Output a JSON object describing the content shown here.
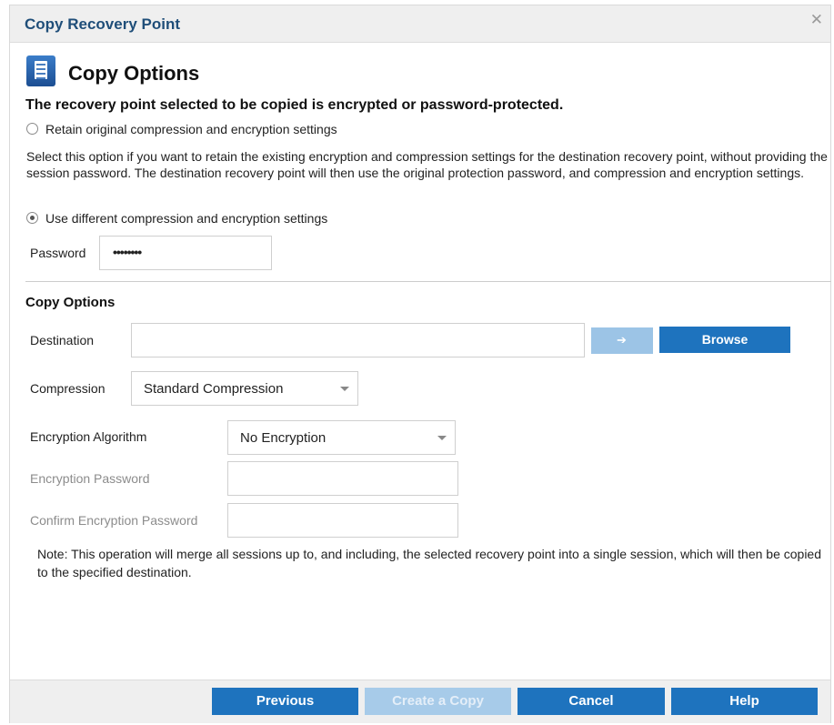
{
  "dialog": {
    "title": "Copy Recovery Point",
    "close_glyph": "✕"
  },
  "header": {
    "title": "Copy Options",
    "icon": "document-icon"
  },
  "warning": "The recovery point selected to be copied is encrypted or password-protected.",
  "options": {
    "retain_label": "Retain original compression and encryption settings",
    "retain_selected": false,
    "retain_description": "Select this option if you want to retain the existing encryption and compression settings for the destination recovery point, without providing the session password. The destination recovery point will then use the original protection password, and compression and encryption settings.",
    "different_label": "Use different compression and encryption settings",
    "different_selected": true
  },
  "password": {
    "label": "Password",
    "value": "••••••••"
  },
  "copy_options": {
    "section_title": "Copy Options",
    "destination_label": "Destination",
    "destination_value": "",
    "go_icon": "arrow-right-icon",
    "go_glyph": "➔",
    "browse_label": "Browse",
    "compression_label": "Compression",
    "compression_value": "Standard Compression",
    "encryption_algorithm_label": "Encryption Algorithm",
    "encryption_algorithm_value": "No Encryption",
    "encryption_password_label": "Encryption Password",
    "confirm_password_label": "Confirm Encryption Password"
  },
  "note": "Note: This operation will merge all sessions up to, and including, the selected recovery point into a single session, which will then be copied to the specified destination.",
  "footer": {
    "previous_label": "Previous",
    "create_copy_label": "Create a Copy",
    "cancel_label": "Cancel",
    "help_label": "Help"
  },
  "colors": {
    "accent": "#1e73be",
    "accent_disabled": "#a7cbe9",
    "title": "#1f4e79",
    "chrome": "#efefef"
  }
}
